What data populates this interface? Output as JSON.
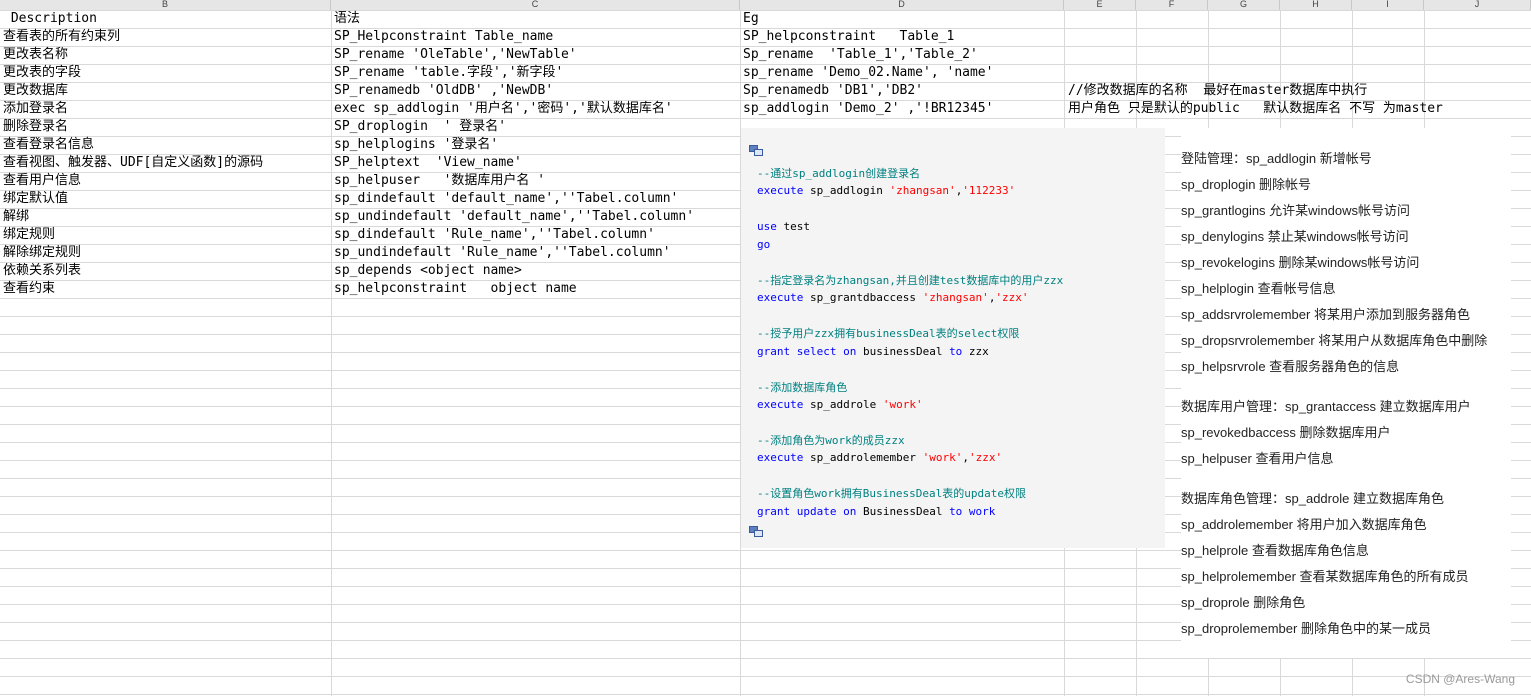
{
  "columns": [
    "B",
    "C",
    "D",
    "E",
    "F",
    "G",
    "H",
    "I",
    "J"
  ],
  "rows": [
    {
      "b": " Description",
      "c": "语法",
      "d": "Eg",
      "e": ""
    },
    {
      "b": "查看表的所有约束列",
      "c": "SP_Helpconstraint Table_name",
      "d": "SP_helpconstraint   Table_1",
      "e": ""
    },
    {
      "b": "更改表名称",
      "c": "SP_rename 'OleTable','NewTable'",
      "d": "Sp_rename  'Table_1','Table_2'",
      "e": ""
    },
    {
      "b": "更改表的字段",
      "c": "SP_rename 'table.字段','新字段'",
      "d": "sp_rename 'Demo_02.Name', 'name'",
      "e": ""
    },
    {
      "b": "更改数据库",
      "c": "SP_renamedb 'OldDB' ,'NewDB'",
      "d": "Sp_renamedb 'DB1','DB2'",
      "e": "//修改数据库的名称  最好在master数据库中执行"
    },
    {
      "b": "添加登录名",
      "c": "exec sp_addlogin '用户名','密码','默认数据库名'",
      "d": "sp_addlogin 'Demo_2' ,'!BR12345'",
      "e": "用户角色 只是默认的public   默认数据库名 不写 为master"
    },
    {
      "b": "删除登录名",
      "c": "SP_droplogin  ' 登录名'",
      "d": "",
      "e": ""
    },
    {
      "b": "查看登录名信息",
      "c": "sp_helplogins '登录名'",
      "d": "",
      "e": ""
    },
    {
      "b": "查看视图、触发器、UDF[自定义函数]的源码",
      "c": "SP_helptext  'View_name'",
      "d": "",
      "e": ""
    },
    {
      "b": "查看用户信息",
      "c": "sp_helpuser   '数据库用户名 '",
      "d": "",
      "e": ""
    },
    {
      "b": "绑定默认值",
      "c": "sp_dindefault 'default_name',''Tabel.column'",
      "d": "",
      "e": ""
    },
    {
      "b": "解绑",
      "c": "sp_undindefault 'default_name',''Tabel.column'",
      "d": "",
      "e": ""
    },
    {
      "b": "绑定规则",
      "c": "sp_dindefault 'Rule_name',''Tabel.column'",
      "d": "",
      "e": ""
    },
    {
      "b": "解除绑定规则",
      "c": "sp_undindefault 'Rule_name',''Tabel.column'",
      "d": "",
      "e": ""
    },
    {
      "b": "依赖关系列表",
      "c": "sp_depends <object name>",
      "d": "",
      "e": ""
    },
    {
      "b": "查看约束",
      "c": "sp_helpconstraint   object name",
      "d": "",
      "e": ""
    }
  ],
  "code_panel": {
    "lines": [
      [
        {
          "t": "cmt",
          "v": "--通过sp_addlogin创建登录名"
        }
      ],
      [
        {
          "t": "kw",
          "v": "execute"
        },
        {
          "t": "id",
          "v": " sp_addlogin "
        },
        {
          "t": "str",
          "v": "'zhangsan'"
        },
        {
          "t": "id",
          "v": ","
        },
        {
          "t": "str",
          "v": "'112233'"
        }
      ],
      [],
      [
        {
          "t": "kw",
          "v": "use"
        },
        {
          "t": "id",
          "v": " test"
        }
      ],
      [
        {
          "t": "kw",
          "v": "go"
        }
      ],
      [],
      [
        {
          "t": "cmt",
          "v": "--指定登录名为zhangsan,并且创建test数据库中的用户zzx"
        }
      ],
      [
        {
          "t": "kw",
          "v": "execute"
        },
        {
          "t": "id",
          "v": " sp_grantdbaccess "
        },
        {
          "t": "str",
          "v": "'zhangsan'"
        },
        {
          "t": "id",
          "v": ","
        },
        {
          "t": "str",
          "v": "'zzx'"
        }
      ],
      [],
      [
        {
          "t": "cmt",
          "v": "--授予用户zzx拥有businessDeal表的select权限"
        }
      ],
      [
        {
          "t": "kw",
          "v": "grant select on"
        },
        {
          "t": "id",
          "v": " businessDeal "
        },
        {
          "t": "kw",
          "v": "to"
        },
        {
          "t": "id",
          "v": " zzx"
        }
      ],
      [],
      [
        {
          "t": "cmt",
          "v": "--添加数据库角色"
        }
      ],
      [
        {
          "t": "kw",
          "v": "execute"
        },
        {
          "t": "id",
          "v": " sp_addrole "
        },
        {
          "t": "str",
          "v": "'work'"
        }
      ],
      [],
      [
        {
          "t": "cmt",
          "v": "--添加角色为work的成员zzx"
        }
      ],
      [
        {
          "t": "kw",
          "v": "execute"
        },
        {
          "t": "id",
          "v": " sp_addrolemember "
        },
        {
          "t": "str",
          "v": "'work'"
        },
        {
          "t": "id",
          "v": ","
        },
        {
          "t": "str",
          "v": "'zzx'"
        }
      ],
      [],
      [
        {
          "t": "cmt",
          "v": "--设置角色work拥有BusinessDeal表的update权限"
        }
      ],
      [
        {
          "t": "kw",
          "v": "grant update on"
        },
        {
          "t": "id",
          "v": " BusinessDeal "
        },
        {
          "t": "kw",
          "v": "to"
        },
        {
          "t": "kw",
          "v": " work"
        }
      ]
    ]
  },
  "side_list": [
    "登陆管理：sp_addlogin 新增帐号",
    "sp_droplogin 删除帐号",
    "sp_grantlogins 允许某windows帐号访问",
    "sp_denylogins 禁止某windows帐号访问",
    "sp_revokelogins 删除某windows帐号访问",
    "sp_helplogin 查看帐号信息",
    "sp_addsrvrolemember 将某用户添加到服务器角色",
    "sp_dropsrvrolemember 将某用户从数据库角色中删除",
    "sp_helpsrvrole 查看服务器角色的信息",
    "",
    "数据库用户管理：sp_grantaccess 建立数据库用户",
    "sp_revokedbaccess 删除数据库用户",
    "sp_helpuser 查看用户信息",
    "",
    "数据库角色管理：sp_addrole 建立数据库角色",
    "sp_addrolemember 将用户加入数据库角色",
    "sp_helprole 查看数据库角色信息",
    "sp_helprolemember 查看某数据库角色的所有成员",
    "sp_droprole 删除角色",
    "sp_droprolemember 删除角色中的某一成员"
  ],
  "watermark": "CSDN @Ares-Wang"
}
